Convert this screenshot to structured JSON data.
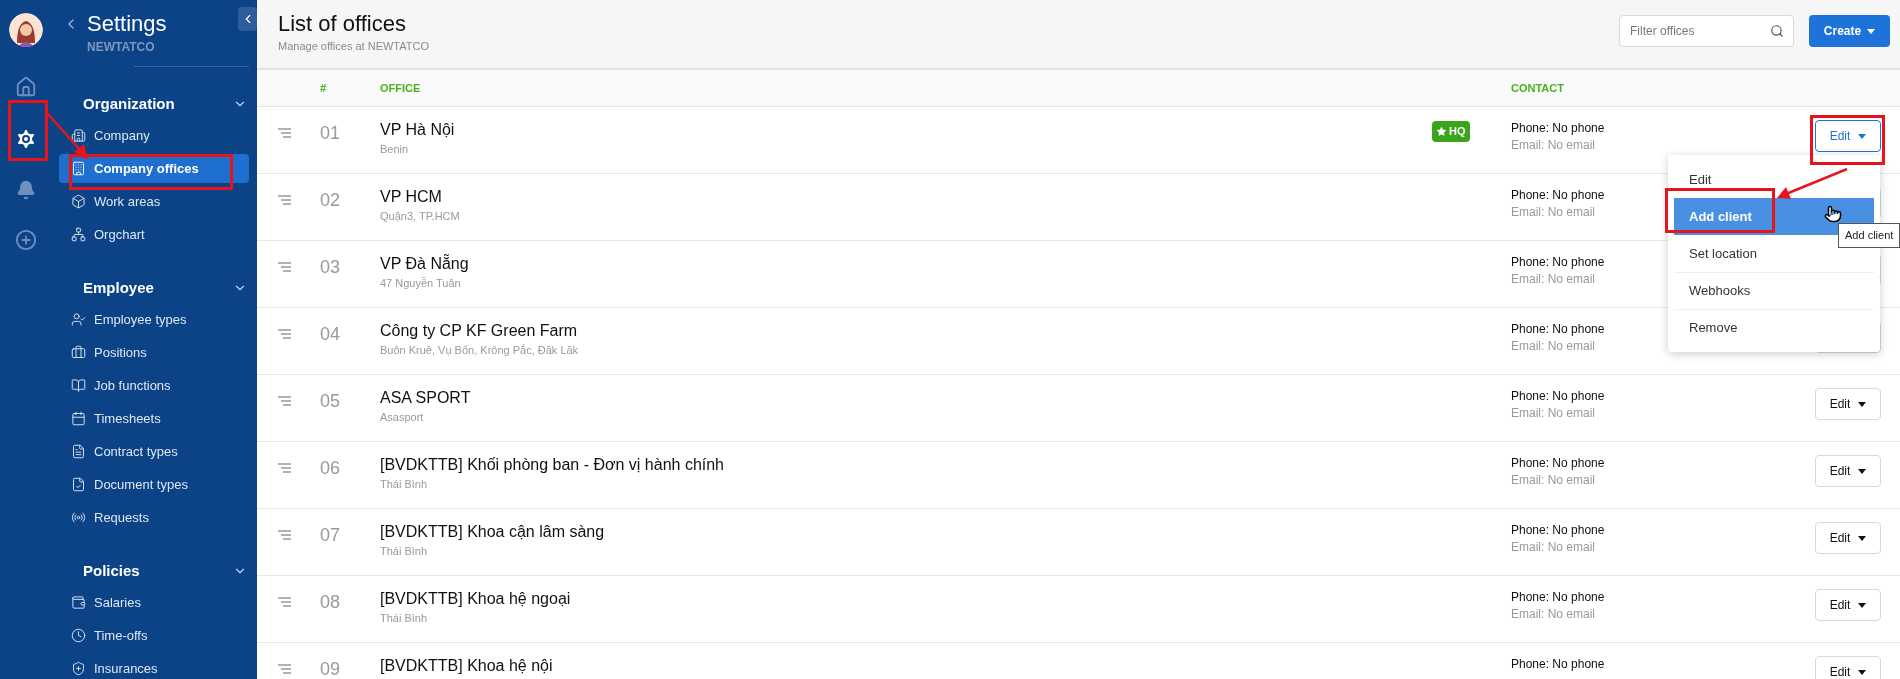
{
  "rail": [
    {
      "kind": "avatar",
      "selected": false
    },
    {
      "kind": "home",
      "selected": false
    },
    {
      "kind": "settings",
      "selected": true
    },
    {
      "kind": "bell",
      "selected": false
    },
    {
      "kind": "add",
      "selected": false
    }
  ],
  "sidebar": {
    "title": "Settings",
    "subtitle": "NEWTATCO",
    "sections": [
      {
        "title": "Organization",
        "expanded": true,
        "items": [
          {
            "label": "Company",
            "selected": false
          },
          {
            "label": "Company offices",
            "selected": true
          },
          {
            "label": "Work areas",
            "selected": false
          },
          {
            "label": "Orgchart",
            "selected": false
          }
        ]
      },
      {
        "title": "Employee",
        "expanded": true,
        "items": [
          {
            "label": "Employee types",
            "selected": false
          },
          {
            "label": "Positions",
            "selected": false
          },
          {
            "label": "Job functions",
            "selected": false
          },
          {
            "label": "Timesheets",
            "selected": false
          },
          {
            "label": "Contract types",
            "selected": false
          },
          {
            "label": "Document types",
            "selected": false
          },
          {
            "label": "Requests",
            "selected": false
          }
        ]
      },
      {
        "title": "Policies",
        "expanded": true,
        "items": [
          {
            "label": "Salaries",
            "selected": false
          },
          {
            "label": "Time-offs",
            "selected": false
          },
          {
            "label": "Insurances",
            "selected": false
          }
        ]
      }
    ]
  },
  "header": {
    "title": "List of offices",
    "subtitle": "Manage offices at NEWTATCO",
    "search": {
      "placeholder": "Filter offices"
    },
    "create_button": "Create"
  },
  "table": {
    "columns": [
      "#",
      "OFFICE",
      "CONTACT"
    ],
    "rows": [
      {
        "number": "01",
        "name": "VP Hà Nội",
        "address": "Benin",
        "badge": "HQ",
        "phone": "Phone: No phone",
        "email": "Email: No email",
        "action": "Edit",
        "action_open": true
      },
      {
        "number": "02",
        "name": "VP HCM",
        "address": "Quận3, TP.HCM",
        "phone": "Phone: No phone",
        "email": "Email: No email",
        "action_open": false
      },
      {
        "number": "03",
        "name": "VP Đà Nẵng",
        "address": "47 Nguyễn Tuân",
        "phone": "Phone: No phone",
        "email": "Email: No email",
        "action_open": false
      },
      {
        "number": "04",
        "name": "Công ty CP KF Green Farm",
        "address": "Buôn Kruê, Vụ Bổn, Krông Pắc, Đăk Lăk",
        "phone": "Phone: No phone",
        "email": "Email: No email",
        "action_open": false
      },
      {
        "number": "05",
        "name": "ASA SPORT",
        "address": "Asasport",
        "phone": "Phone: No phone",
        "email": "Email: No email",
        "action": "Edit",
        "action_open": false
      },
      {
        "number": "06",
        "name": "[BVDKTTB] Khối phòng ban - Đơn vị hành chính",
        "address": "Thái Bình",
        "phone": "Phone: No phone",
        "email": "Email: No email",
        "action": "Edit",
        "action_open": false
      },
      {
        "number": "07",
        "name": "[BVDKTTB] Khoa cận lâm sàng",
        "address": "Thái Bình",
        "phone": "Phone: No phone",
        "email": "Email: No email",
        "action": "Edit",
        "action_open": false
      },
      {
        "number": "08",
        "name": "[BVDKTTB] Khoa hệ ngoại",
        "address": "Thái Bình",
        "phone": "Phone: No phone",
        "email": "Email: No email",
        "action": "Edit",
        "action_open": false
      },
      {
        "number": "09",
        "name": "[BVDKTTB] Khoa hệ nội",
        "phone": "Phone: No phone",
        "action": "Edit",
        "action_open": false
      }
    ]
  },
  "menu": {
    "items": [
      {
        "label": "Edit",
        "selected": false
      },
      {
        "label": "Add client",
        "selected": true
      },
      {
        "label": "Set location",
        "selected": false
      },
      {
        "label": "Webhooks",
        "selected": false
      },
      {
        "label": "Remove",
        "selected": false
      }
    ],
    "tooltip": "Add client"
  }
}
